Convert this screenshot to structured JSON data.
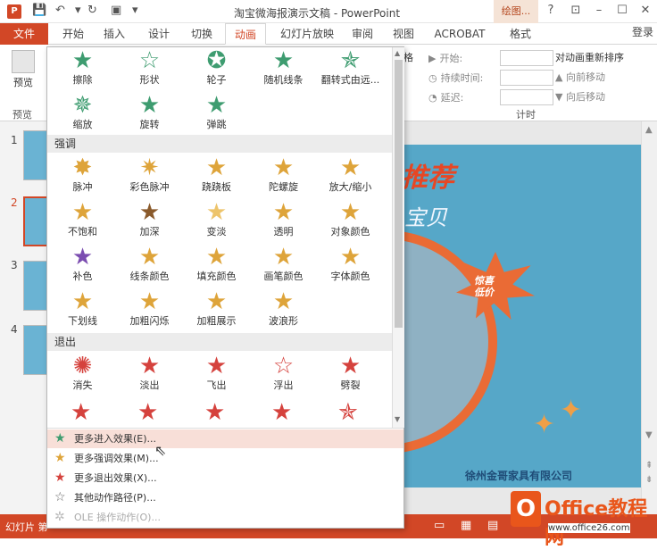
{
  "titlebar": {
    "app_icon": "P",
    "title": "淘宝微海报演示文稿 - PowerPoint",
    "context_tab": "绘图...",
    "help": "?"
  },
  "tabs": {
    "file": "文件",
    "items": [
      "开始",
      "插入",
      "设计",
      "切换",
      "动画",
      "幻灯片放映",
      "审阅",
      "视图",
      "ACROBAT",
      "格式"
    ],
    "login": "登录"
  },
  "ribbon": {
    "preview_label": "预览",
    "preview_group": "预览",
    "anim_label_partial": "格",
    "start_label": "开始:",
    "duration_label": "持续时间:",
    "delay_label": "延迟:",
    "reorder_title": "对动画重新排序",
    "move_earlier": "向前移动",
    "move_later": "向后移动",
    "timing_group": "计时"
  },
  "gallery": {
    "entrance_row1": [
      "擦除",
      "形状",
      "轮子",
      "随机线条",
      "翻转式由远..."
    ],
    "entrance_row2": [
      "缩放",
      "旋转",
      "弹跳"
    ],
    "emphasis_header": "强调",
    "emphasis_row1": [
      "脉冲",
      "彩色脉冲",
      "跷跷板",
      "陀螺旋",
      "放大/缩小"
    ],
    "emphasis_row2": [
      "不饱和",
      "加深",
      "变淡",
      "透明",
      "对象颜色"
    ],
    "emphasis_row3": [
      "补色",
      "线条颜色",
      "填充颜色",
      "画笔颜色",
      "字体颜色"
    ],
    "emphasis_row4": [
      "下划线",
      "加粗闪烁",
      "加粗展示",
      "波浪形"
    ],
    "exit_header": "退出",
    "exit_row1": [
      "消失",
      "淡出",
      "飞出",
      "浮出",
      "劈裂"
    ]
  },
  "menu": {
    "more_entrance": "更多进入效果(E)...",
    "more_emphasis": "更多强调效果(M)...",
    "more_exit": "更多退出效果(X)...",
    "other_path": "其他动作路径(P)...",
    "ole": "OLE 操作动作(O)..."
  },
  "slides": {
    "numbers": [
      "1",
      "2",
      "3",
      "4"
    ]
  },
  "slide": {
    "title": "推荐",
    "subtitle": "宝贝",
    "burst_text1": "惊喜",
    "burst_text2": "低价",
    "company": "徐州金哥家具有限公司"
  },
  "status": {
    "left": "幻灯片 第"
  },
  "watermark": {
    "brand": "Office教程网",
    "url": "www.office26.com"
  },
  "colors": {
    "accent": "#d24726",
    "entrance": "#3e9c70",
    "emphasis": "#dea43a",
    "exit": "#d5423d"
  }
}
